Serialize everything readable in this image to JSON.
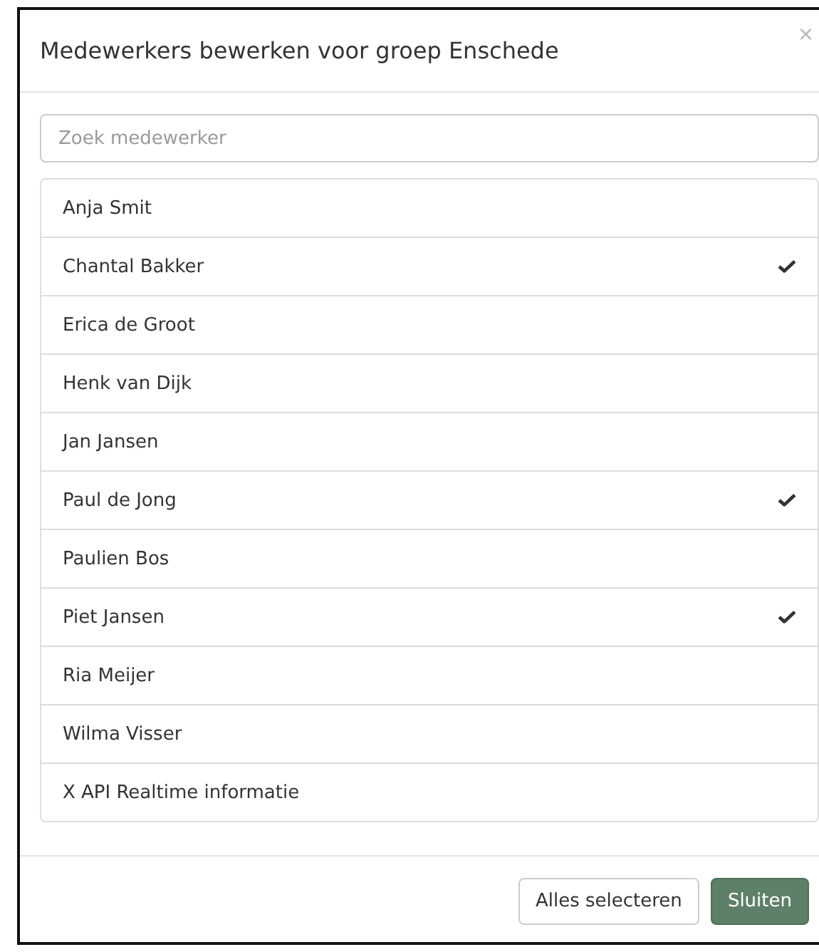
{
  "dialog": {
    "title": "Medewerkers bewerken voor groep Enschede",
    "close": "×"
  },
  "search": {
    "placeholder": "Zoek medewerker"
  },
  "employees": [
    {
      "name": "Anja Smit",
      "selected": false
    },
    {
      "name": "Chantal Bakker",
      "selected": true
    },
    {
      "name": "Erica de Groot",
      "selected": false
    },
    {
      "name": "Henk van Dijk",
      "selected": false
    },
    {
      "name": "Jan Jansen",
      "selected": false
    },
    {
      "name": "Paul de Jong",
      "selected": true
    },
    {
      "name": "Paulien Bos",
      "selected": false
    },
    {
      "name": "Piet Jansen",
      "selected": true
    },
    {
      "name": "Ria Meijer",
      "selected": false
    },
    {
      "name": "Wilma Visser",
      "selected": false
    },
    {
      "name": "X API Realtime informatie",
      "selected": false
    }
  ],
  "buttons": [
    {
      "label": "Alles selecteren",
      "kind": "default"
    },
    {
      "label": "Sluiten",
      "kind": "primary"
    }
  ]
}
